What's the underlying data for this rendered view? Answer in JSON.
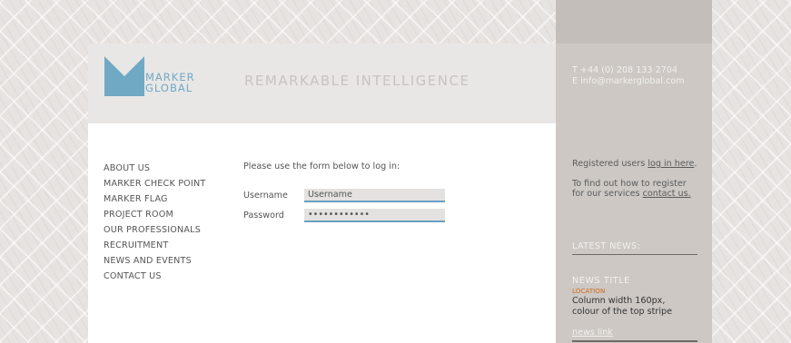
{
  "brand": {
    "logo_line1": "MARKER",
    "logo_line2": "GLOBAL",
    "tagline": "REMARKABLE INTELLIGENCE",
    "accent_color": "#6fa9c4"
  },
  "contact": {
    "phone": "T  +44 (0) 208 133 2704",
    "email": "E  info@markerglobal.com"
  },
  "nav": {
    "items": [
      {
        "label": "ABOUT US"
      },
      {
        "label": "MARKER CHECK POINT"
      },
      {
        "label": "MARKER FLAG"
      },
      {
        "label": "PROJECT ROOM"
      },
      {
        "label": "OUR PROFESSIONALS"
      },
      {
        "label": "RECRUITMENT"
      },
      {
        "label": "NEWS AND EVENTS"
      },
      {
        "label": "CONTACT US"
      }
    ]
  },
  "login": {
    "intro": "Please use the form below to log in:",
    "username_label": "Username",
    "username_value": "Username",
    "password_label": "Password",
    "password_value": "••••••••••••"
  },
  "sidebar": {
    "registered_text": "Registered users ",
    "registered_link": "log in here",
    "registered_end": ".",
    "register_line1": "To find out how to register",
    "register_line2": "for our services ",
    "register_link": "contact us.",
    "latest_news": "LATEST NEWS:",
    "news_title": "NEWS TITLE",
    "news_location": "LOCATION",
    "news_body_line1": "Column width 160px,",
    "news_body_line2": "colour of the top stripe",
    "news_link": "news link"
  }
}
